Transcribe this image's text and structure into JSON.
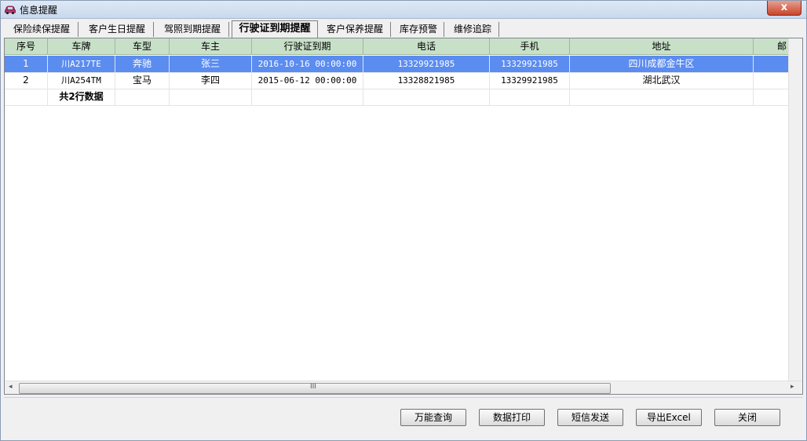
{
  "window": {
    "title": "信息提醒",
    "close_label": "x"
  },
  "tabs": [
    {
      "label": "保险续保提醒"
    },
    {
      "label": "客户生日提醒"
    },
    {
      "label": "驾照到期提醒"
    },
    {
      "label": "行驶证到期提醒"
    },
    {
      "label": "客户保养提醒"
    },
    {
      "label": "库存预警"
    },
    {
      "label": "维修追踪"
    }
  ],
  "table": {
    "columns": [
      "序号",
      "车牌",
      "车型",
      "车主",
      "行驶证到期",
      "电话",
      "手机",
      "地址",
      "邮"
    ],
    "rows": [
      [
        "1",
        "川A217TE",
        "奔驰",
        "张三",
        "2016-10-16 00:00:00",
        "13329921985",
        "13329921985",
        "四川成都金牛区",
        ""
      ],
      [
        "2",
        "川A254TM",
        "宝马",
        "李四",
        "2015-06-12 00:00:00",
        "13328821985",
        "13329921985",
        "湖北武汉",
        ""
      ]
    ],
    "summary": "共2行数据"
  },
  "scrollbar": {
    "grip": "III",
    "left_arrow": "◂",
    "right_arrow": "▸"
  },
  "buttons": {
    "query": "万能查询",
    "print": "数据打印",
    "sms": "短信发送",
    "export": "导出Excel",
    "close": "关闭"
  },
  "colors": {
    "selected_row": "#5b8cf0",
    "header_bg": "#c8e0c8"
  },
  "icons": {
    "title": "car-icon"
  }
}
